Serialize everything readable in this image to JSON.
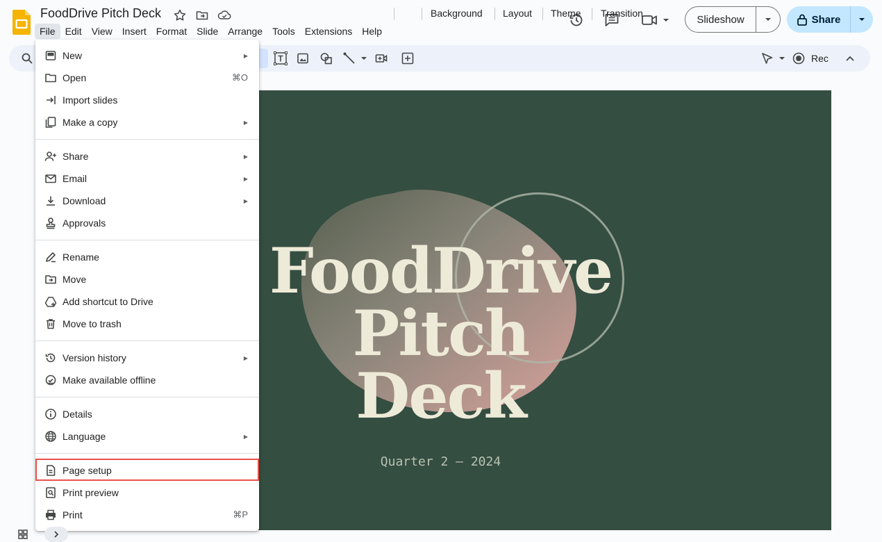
{
  "header": {
    "doc_title": "FoodDrive Pitch Deck",
    "slideshow_label": "Slideshow",
    "share_label": "Share",
    "icons": [
      "star-icon",
      "move-folder-icon",
      "cloud-saved-icon",
      "version-history-icon",
      "comments-icon",
      "meet-camera-icon"
    ]
  },
  "menubar": [
    "File",
    "Edit",
    "View",
    "Insert",
    "Format",
    "Slide",
    "Arrange",
    "Tools",
    "Extensions",
    "Help"
  ],
  "toolbar": {
    "background": "Background",
    "layout": "Layout",
    "theme": "Theme",
    "transition": "Transition",
    "rec": "Rec"
  },
  "file_menu": {
    "new": "New",
    "open": "Open",
    "open_shortcut": "⌘O",
    "import_slides": "Import slides",
    "make_a_copy": "Make a copy",
    "share": "Share",
    "email": "Email",
    "download": "Download",
    "approvals": "Approvals",
    "rename": "Rename",
    "move": "Move",
    "add_shortcut": "Add shortcut to Drive",
    "move_to_trash": "Move to trash",
    "version_history": "Version history",
    "make_offline": "Make available offline",
    "details": "Details",
    "language": "Language",
    "page_setup": "Page setup",
    "print_preview": "Print preview",
    "print": "Print",
    "print_shortcut": "⌘P"
  },
  "slide": {
    "title_line1": "FoodDrive",
    "title_line2": "Pitch Deck",
    "subtitle": "Quarter 2 — 2024",
    "background_color": "#344e41"
  },
  "colors": {
    "accent": "#c2e7ff",
    "highlight_border": "#e8514a",
    "slides_logo": "#f4b400"
  }
}
